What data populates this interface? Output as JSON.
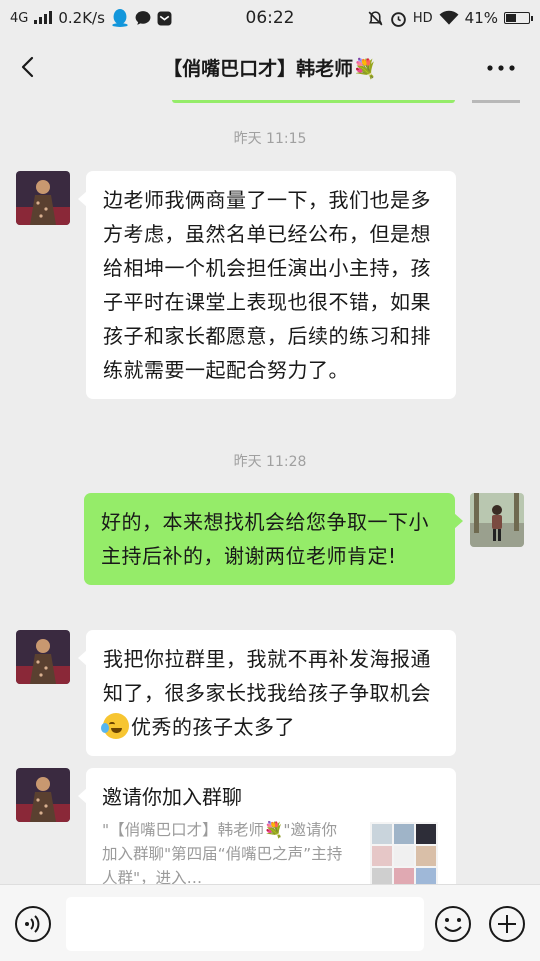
{
  "status_bar": {
    "network": "4G",
    "speed": "0.2K/s",
    "time": "06:22",
    "hd": "HD",
    "battery": "41%",
    "battery_level": 0.41
  },
  "header": {
    "title": "【俏嘴巴口才】韩老师💐",
    "back_icon": "chevron-left-icon",
    "more_icon": "more-dots-icon"
  },
  "messages": [
    {
      "type": "timestamp",
      "text": "昨天 11:15"
    },
    {
      "type": "text",
      "direction": "in",
      "text": "边老师我俩商量了一下，我们也是多方考虑，虽然名单已经公布，但是想给相坤一个机会担任演出小主持，孩子平时在课堂上表现也很不错，如果孩子和家长都愿意，后续的练习和排练就需要一起配合努力了。"
    },
    {
      "type": "timestamp",
      "text": "昨天 11:28"
    },
    {
      "type": "text",
      "direction": "out",
      "text": "好的，本来想找机会给您争取一下小主持后补的，谢谢两位老师肯定!"
    },
    {
      "type": "text",
      "direction": "in",
      "text_before": "我把你拉群里，我就不再补发海报通知了，很多家长找我给孩子争取机会",
      "emoji": "laughing-tears-emoji",
      "text_after": "优秀的孩子太多了"
    },
    {
      "type": "card",
      "direction": "in",
      "title": "邀请你加入群聊",
      "desc": "\"【俏嘴巴口才】韩老师💐\"邀请你加入群聊\"第四届“俏嘴巴之声”主持人群\"，进入…"
    }
  ],
  "input_bar": {
    "voice_icon": "voice-icon",
    "emoji_icon": "smiley-icon",
    "plus_icon": "plus-icon",
    "placeholder": ""
  }
}
